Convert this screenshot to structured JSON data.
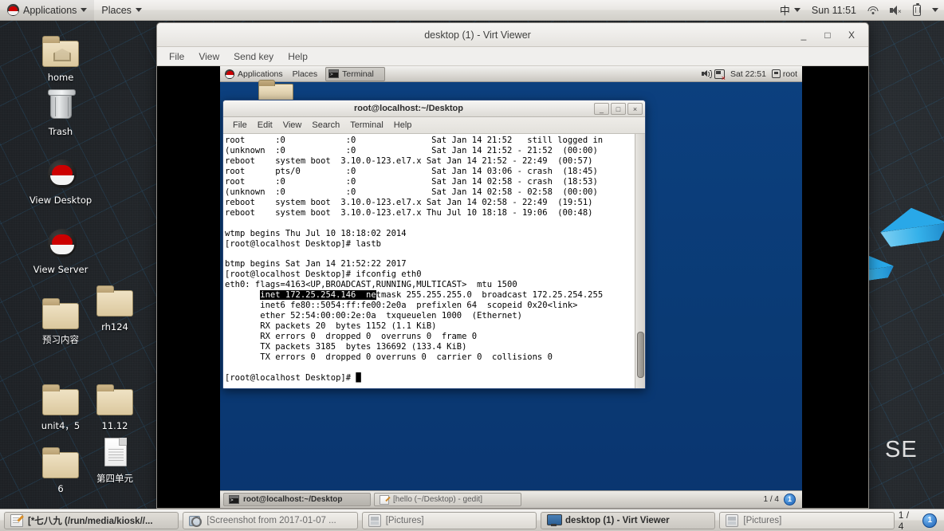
{
  "host_panel": {
    "applications_label": "Applications",
    "places_label": "Places",
    "ime_label": "中",
    "clock": "Sun 11:51"
  },
  "desktop_icons": [
    {
      "label": "home",
      "icon": "folder-home-icon"
    },
    {
      "label": "Trash",
      "icon": "trash-icon"
    },
    {
      "label": "View Desktop",
      "icon": "redhat-icon"
    },
    {
      "label": "View Server",
      "icon": "redhat-icon"
    },
    {
      "label": "预习内容",
      "icon": "folder-icon"
    },
    {
      "label": "rh124",
      "icon": "folder-icon"
    },
    {
      "label": "unit4，5",
      "icon": "folder-icon"
    },
    {
      "label": "11.12",
      "icon": "folder-icon"
    },
    {
      "label": "6",
      "icon": "folder-icon"
    },
    {
      "label": "第四单元",
      "icon": "document-icon"
    }
  ],
  "wallpaper_text": "SE",
  "virt_viewer": {
    "title": "desktop (1) - Virt Viewer",
    "minimize": "_",
    "maximize": "□",
    "close": "X",
    "menus": [
      "File",
      "View",
      "Send key",
      "Help"
    ]
  },
  "vm_panel": {
    "applications_label": "Applications",
    "places_label": "Places",
    "window_button": "Terminal",
    "clock": "Sat 22:51",
    "user": "root"
  },
  "terminal": {
    "title": "root@localhost:~/Desktop",
    "minimize": "_",
    "maximize": "□",
    "close": "×",
    "menus": [
      "File",
      "Edit",
      "View",
      "Search",
      "Terminal",
      "Help"
    ],
    "lines_before": "root      :0            :0               Sat Jan 14 21:52   still logged in\n(unknown  :0            :0               Sat Jan 14 21:52 - 21:52  (00:00)\nreboot    system boot  3.10.0-123.el7.x Sat Jan 14 21:52 - 22:49  (00:57)\nroot      pts/0         :0               Sat Jan 14 03:06 - crash  (18:45)\nroot      :0            :0               Sat Jan 14 02:58 - crash  (18:53)\n(unknown  :0            :0               Sat Jan 14 02:58 - 02:58  (00:00)\nreboot    system boot  3.10.0-123.el7.x Sat Jan 14 02:58 - 22:49  (19:51)\nreboot    system boot  3.10.0-123.el7.x Thu Jul 10 18:18 - 19:06  (00:48)\n\nwtmp begins Thu Jul 10 18:18:02 2014\n[root@localhost Desktop]# lastb\n\nbtmp begins Sat Jan 14 21:52:22 2017\n[root@localhost Desktop]# ifconfig eth0\neth0: flags=4163<UP,BROADCAST,RUNNING,MULTICAST>  mtu 1500\n       ",
    "selected_text": "inet 172.25.254.146  ne",
    "lines_after": "tmask 255.255.255.0  broadcast 172.25.254.255\n       inet6 fe80::5054:ff:fe00:2e0a  prefixlen 64  scopeid 0x20<link>\n       ether 52:54:00:00:2e:0a  txqueuelen 1000  (Ethernet)\n       RX packets 20  bytes 1152 (1.1 KiB)\n       RX errors 0  dropped 0  overruns 0  frame 0\n       TX packets 3185  bytes 136692 (133.4 KiB)\n       TX errors 0  dropped 0 overruns 0  carrier 0  collisions 0\n\n[root@localhost Desktop]# ",
    "cursor": "█"
  },
  "vm_taskbar": {
    "tasks": [
      {
        "label": "root@localhost:~/Desktop",
        "icon": "terminal-icon",
        "active": true
      },
      {
        "label": "[hello (~/Desktop) - gedit]",
        "icon": "gedit-icon",
        "active": false
      }
    ],
    "workspace": "1 / 4",
    "workspace_badge": "1"
  },
  "host_taskbar": {
    "tasks": [
      {
        "label": "[*七八九 (/run/media/kiosk//...",
        "icon": "gedit-icon",
        "active": true
      },
      {
        "label": "[Screenshot from 2017-01-07 ...",
        "icon": "screenshot-icon",
        "active": false
      },
      {
        "label": "[Pictures]",
        "icon": "pictures-icon",
        "active": false
      },
      {
        "label": "desktop (1) - Virt Viewer",
        "icon": "monitor-icon",
        "active": true
      },
      {
        "label": "[Pictures]",
        "icon": "pictures-icon",
        "active": false
      }
    ],
    "workspace": "1 / 4",
    "workspace_badge": "1"
  },
  "colors": {
    "vm_desktop_blue": "#0c407f",
    "selection_black": "#000000",
    "redhat_red": "#cc0000",
    "accent_blue": "#1a5fb4"
  }
}
